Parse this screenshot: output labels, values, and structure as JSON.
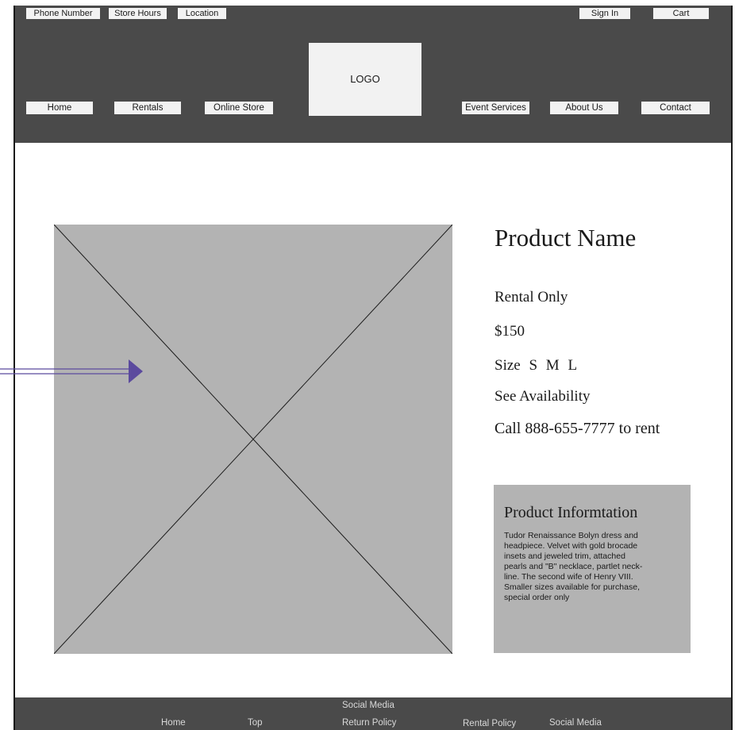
{
  "topbar": {
    "phone_number": "Phone Number",
    "store_hours": "Store Hours",
    "location": "Location",
    "sign_in": "Sign In",
    "cart": "Cart"
  },
  "logo": {
    "label": "LOGO"
  },
  "nav": {
    "home": "Home",
    "rentals": "Rentals",
    "online_store": "Online Store",
    "event_services": "Event Services",
    "about_us": "About Us",
    "contact": "Contact"
  },
  "product": {
    "name": "Product Name",
    "rental_only": "Rental Only",
    "price": "$150",
    "size_label": "Size",
    "sizes": [
      "S",
      "M",
      "L"
    ],
    "availability": "See Availability",
    "call_to_rent": "Call 888-655-7777 to rent"
  },
  "product_info": {
    "title": "Product Informtation",
    "lines": [
      "Tudor Renaissance Bolyn dress and",
      "headpiece.  Velvet with gold brocade",
      "insets and jeweled trim, attached",
      "pearls and \"B\" necklace, partlet neck-",
      "line. The second wife of Henry VIII.",
      "Smaller sizes available for purchase,",
      "special order only"
    ]
  },
  "footer": {
    "home": "Home",
    "top": "Top",
    "social_media_top": "Social Media",
    "return_policy": "Return Policy",
    "rental_policy": "Rental Policy",
    "social_media": "Social Media"
  },
  "colors": {
    "header_bg": "#4a4a4a",
    "button_bg": "#f2f2f2",
    "placeholder_gray": "#b3b3b3",
    "arrow": "#5b4a9e"
  }
}
